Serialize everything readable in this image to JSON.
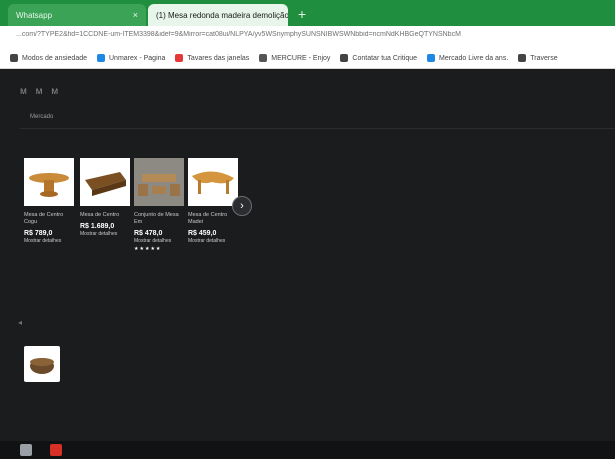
{
  "browser": {
    "tabs": [
      {
        "label": "Whatsapp",
        "close": "×"
      },
      {
        "label": "(1) Mesa redonda madeira demolição",
        "close": "×"
      }
    ],
    "new_tab": "+",
    "url": "...com/?TYPE2&fid=1CCDNE-um-ITEM3398&idef=9&Mirror=cat08ui/NLPYA/yv5WSnymphySUNSNIBWSWNbbid=ncmNdKHBGeQTYNSNbcM",
    "bookmarks": [
      {
        "label": "Modos de ansiedade",
        "color": "#444444"
      },
      {
        "label": "Unmarex - Pagina",
        "color": "#1e88e5"
      },
      {
        "label": "Tavares das janelas",
        "color": "#e53935"
      },
      {
        "label": "MERCURE - Enjoy",
        "color": "#555555"
      },
      {
        "label": "Contatar tua Critique",
        "color": "#444444"
      },
      {
        "label": "Mercado Livre da ans.",
        "color": "#1e88e5"
      },
      {
        "label": "Traverse",
        "color": "#444444"
      }
    ]
  },
  "site": {
    "logo": "ᴍ ᴍ ᴍ",
    "breadcrumb": "Mercado"
  },
  "products": [
    {
      "title": "Mesa de Centro Cogu",
      "price": "R$ 789,0",
      "installments": "Mostrar detalhes",
      "stars": ""
    },
    {
      "title": "Mesa de Centro",
      "price": "R$ 1.689,0",
      "installments": "Mostrar detalhes",
      "stars": ""
    },
    {
      "title": "Conjunto de Mesa Em",
      "price": "R$ 478,0",
      "installments": "Mostrar detalhes",
      "stars": "★★★★★"
    },
    {
      "title": "Mesa de Centro Madei",
      "price": "R$ 459,0",
      "installments": "Mostrar detalhes",
      "stars": ""
    }
  ],
  "carousel": {
    "next": "›"
  },
  "section_marker": "◂",
  "colors": {
    "tab_green": "#1f8f3f",
    "page_bg": "#1b1c1e",
    "wood": "#c98a3a"
  }
}
